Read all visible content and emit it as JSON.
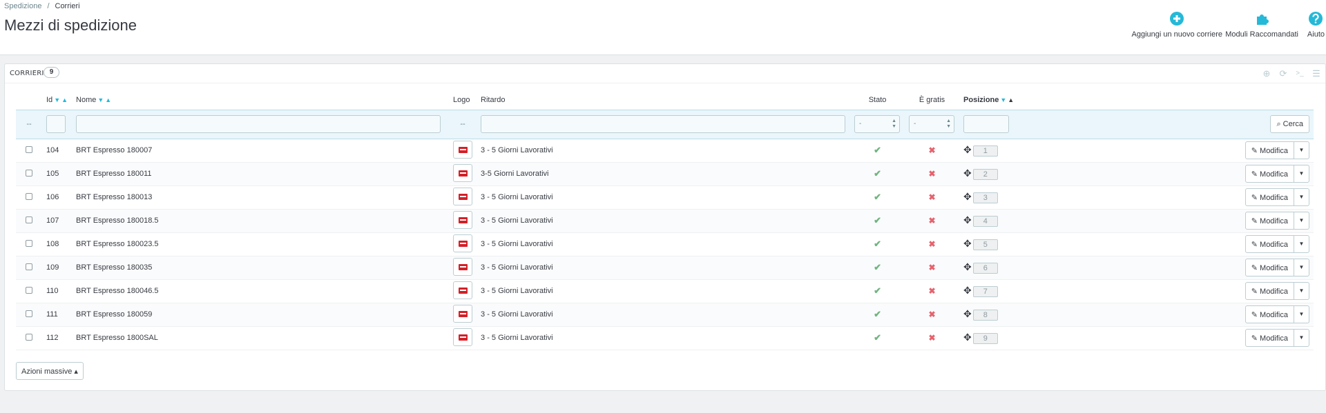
{
  "breadcrumb": {
    "parent": "Spedizione",
    "separator": "/",
    "current": "Corrieri"
  },
  "page_title": "Mezzi di spedizione",
  "toolbar": {
    "add_carrier": "Aggiungi un nuovo corriere",
    "recommended_modules": "Moduli Raccomandati",
    "help": "Aiuto",
    "icon_color": "#25b9d7"
  },
  "panel": {
    "title": "CORRIERI",
    "count": "9",
    "icons": [
      "add-icon",
      "refresh-icon",
      "terminal-icon",
      "database-icon"
    ]
  },
  "table": {
    "headers": {
      "id": "Id",
      "name": "Nome",
      "logo": "Logo",
      "delay": "Ritardo",
      "status": "Stato",
      "free": "È gratis",
      "position": "Posizione"
    },
    "sort_down": "▼",
    "sort_up": "▲",
    "filter": {
      "dash": "--",
      "status_value": "-",
      "free_value": "-",
      "search_label": "Cerca"
    },
    "rows": [
      {
        "id": "104",
        "name": "BRT Espresso 180007",
        "delay": "3 - 5 Giorni Lavorativi",
        "active": true,
        "is_free": false,
        "position": "1"
      },
      {
        "id": "105",
        "name": "BRT Espresso 180011",
        "delay": "3-5 Giorni Lavorativi",
        "active": true,
        "is_free": false,
        "position": "2"
      },
      {
        "id": "106",
        "name": "BRT Espresso 180013",
        "delay": "3 - 5 Giorni Lavorativi",
        "active": true,
        "is_free": false,
        "position": "3"
      },
      {
        "id": "107",
        "name": "BRT Espresso 180018.5",
        "delay": "3 - 5 Giorni Lavorativi",
        "active": true,
        "is_free": false,
        "position": "4"
      },
      {
        "id": "108",
        "name": "BRT Espresso 180023.5",
        "delay": "3 - 5 Giorni Lavorativi",
        "active": true,
        "is_free": false,
        "position": "5"
      },
      {
        "id": "109",
        "name": "BRT Espresso 180035",
        "delay": "3 - 5 Giorni Lavorativi",
        "active": true,
        "is_free": false,
        "position": "6"
      },
      {
        "id": "110",
        "name": "BRT Espresso 180046.5",
        "delay": "3 - 5 Giorni Lavorativi",
        "active": true,
        "is_free": false,
        "position": "7"
      },
      {
        "id": "111",
        "name": "BRT Espresso 180059",
        "delay": "3 - 5 Giorni Lavorativi",
        "active": true,
        "is_free": false,
        "position": "8"
      },
      {
        "id": "112",
        "name": "BRT Espresso 1800SAL",
        "delay": "3 - 5 Giorni Lavorativi",
        "active": true,
        "is_free": false,
        "position": "9"
      }
    ],
    "edit_label": "Modifica",
    "check_glyph": "✔",
    "cross_glyph": "✖",
    "move_glyph": "✥"
  },
  "bulk_actions": "Azioni massive ▴"
}
